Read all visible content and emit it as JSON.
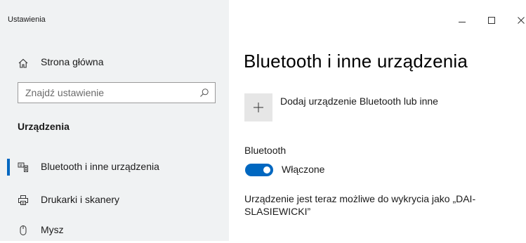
{
  "window": {
    "title": "Ustawienia",
    "controls": {
      "minimize": "minimize-icon",
      "maximize": "maximize-icon",
      "close": "close-icon"
    }
  },
  "sidebar": {
    "home_label": "Strona główna",
    "home_icon": "home-icon",
    "search": {
      "placeholder": "Znajdź ustawienie",
      "value": "",
      "icon": "search-icon"
    },
    "section_title": "Urządzenia",
    "items": [
      {
        "label": "Bluetooth i inne urządzenia",
        "icon": "bluetooth-devices-icon",
        "selected": true
      },
      {
        "label": "Drukarki i skanery",
        "icon": "printer-icon",
        "selected": false
      },
      {
        "label": "Mysz",
        "icon": "mouse-icon",
        "selected": false
      }
    ]
  },
  "main": {
    "title": "Bluetooth i inne urządzenia",
    "add_device_label": "Dodaj urządzenie Bluetooth lub inne",
    "bluetooth_heading": "Bluetooth",
    "toggle_state_label": "Włączone",
    "toggle_on": true,
    "discoverable_text": "Urządzenie jest teraz możliwe do wykrycia jako „DAI-SLASIEWICKI”"
  },
  "colors": {
    "accent": "#0067c0",
    "sidebar_bg": "#f0f2f3",
    "add_button_bg": "#e6e6e6"
  }
}
